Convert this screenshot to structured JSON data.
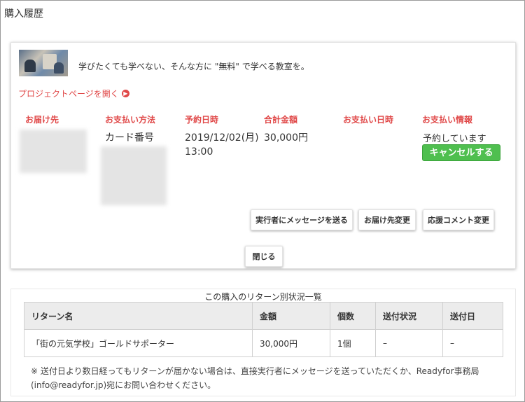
{
  "page": {
    "title": "購入履歴"
  },
  "purchase": {
    "project_title": "学びたくても学べない、そんな方に \"無料\" で学べる教室を。",
    "project_link": "プロジェクトページを開く",
    "columns": [
      "お届け先",
      "お支払い方法",
      "予約日時",
      "合計金額",
      "お支払い日時",
      "お支払い情報"
    ],
    "payment_method": "カード番号",
    "reserved_datetime": "2019/12/02(月) 13:00",
    "total": "30,000円",
    "payment_status": "予約しています",
    "cancel_label": "キャンセルする",
    "actions": {
      "message": "実行者にメッセージを送る",
      "change_address": "お届け先変更",
      "change_comment": "応援コメント変更",
      "close": "閉じる"
    }
  },
  "returns": {
    "title": "この購入のリターン別状況一覧",
    "headers": [
      "リターン名",
      "金額",
      "個数",
      "送付状況",
      "送付日"
    ],
    "rows": [
      [
        "「街の元気学校」ゴールドサポーター",
        "30,000円",
        "1個",
        "–",
        "–"
      ]
    ],
    "note": "※ 送付日より数日経ってもリターンが届かない場合は、直接実行者にメッセージを送っていただくか、Readyfor事務局(info@readyfor.jp)宛にお問い合わせください。"
  },
  "colors": {
    "accent": "#e04848",
    "cancel_button": "#4fbf4f"
  },
  "icons": {
    "project_link": "arrow-circle-right-icon"
  }
}
